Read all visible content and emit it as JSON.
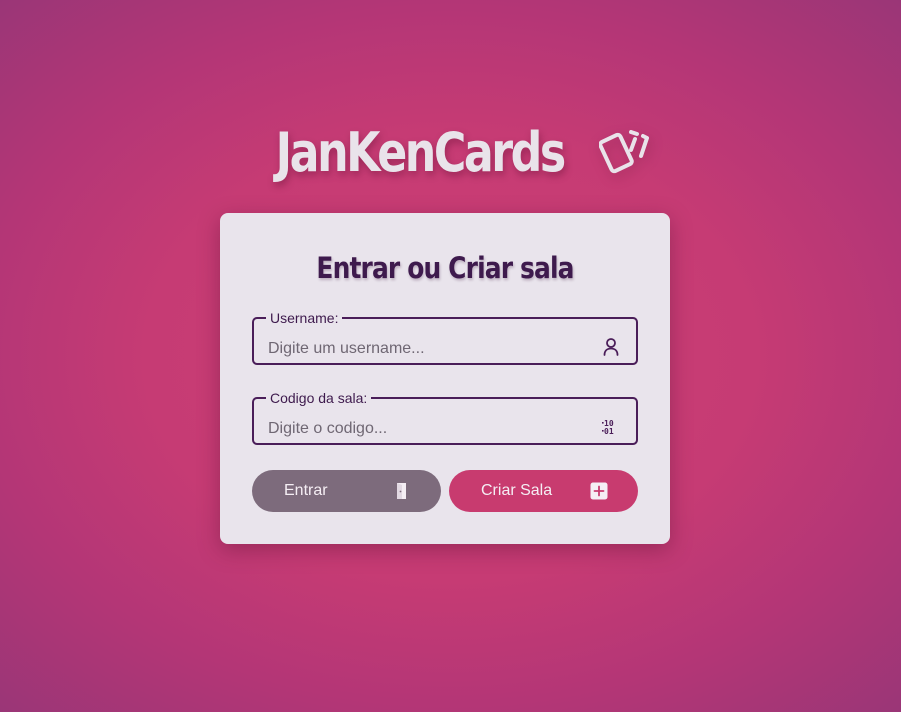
{
  "app": {
    "logo_text": "JanKenCards",
    "logo_icon": "cards-icon"
  },
  "form": {
    "title": "Entrar ou Criar sala",
    "username": {
      "label": "Username:",
      "placeholder": "Digite um username...",
      "value": "",
      "icon": "user-icon"
    },
    "room_code": {
      "label": "Codigo da sala:",
      "placeholder": "Digite o codigo...",
      "value": "",
      "icon": "binary-icon"
    },
    "enter_button": {
      "label": "Entrar",
      "icon": "door-icon",
      "color": "#7d6b7c"
    },
    "create_button": {
      "label": "Criar Sala",
      "icon": "plus-square-icon",
      "color": "#c83b6f"
    }
  },
  "colors": {
    "background": "#c63b74",
    "card": "#e9e4ec",
    "accent": "#4a1d59"
  }
}
